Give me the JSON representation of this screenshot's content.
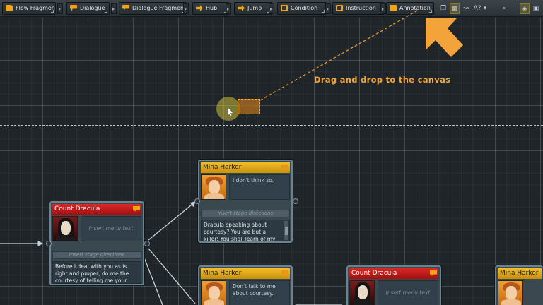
{
  "toolbar": {
    "buttons": [
      {
        "label": "Flow Fragment",
        "icon": "flow-fragment-icon"
      },
      {
        "label": "Dialogue",
        "icon": "dialogue-icon"
      },
      {
        "label": "Dialogue Fragment",
        "icon": "dialogue-fragment-icon"
      },
      {
        "label": "Hub",
        "icon": "hub-icon"
      },
      {
        "label": "Jump",
        "icon": "jump-icon"
      },
      {
        "label": "Condition",
        "icon": "condition-icon"
      },
      {
        "label": "Instruction",
        "icon": "instruction-icon"
      },
      {
        "label": "Annotation",
        "icon": "annotation-icon"
      }
    ],
    "tools": {
      "zoom_text": "A?"
    }
  },
  "hint": {
    "text": "Drag and drop to the canvas",
    "color": "#f2a53a"
  },
  "nodes": {
    "mina1": {
      "speaker": "Mina Harker",
      "menu_text": "I don't think so.",
      "stage_placeholder": "Insert stage directions",
      "text": "Dracula speaking about courtesy? You are but a killer! You shall learn of my name,"
    },
    "dracula1": {
      "speaker": "Count Dracula",
      "menu_placeholder": "Insert menu text",
      "stage_placeholder": "Insert stage directions",
      "text": "Before I deal with you as is right and proper, do me the courtesy of telling me your name."
    },
    "mina2": {
      "speaker": "Mina Harker",
      "menu_text": "Don't talk to me about courtesy."
    },
    "dracula2": {
      "speaker": "Count Dracula",
      "menu_placeholder": "Insert menu text"
    },
    "mina3": {
      "speaker": "Mina Harker"
    }
  },
  "colors": {
    "accent": "#f0a512",
    "header_yellow": "#e0a81a",
    "header_red": "#c01c1c",
    "wire": "#c9d3da"
  }
}
